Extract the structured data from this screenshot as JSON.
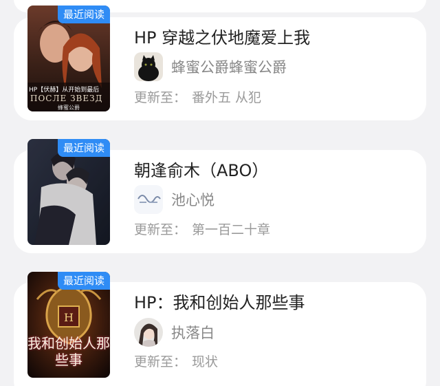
{
  "badge_label": "最近阅读",
  "update_prefix": "更新至：",
  "books": [
    {
      "title": "HP 穿越之伏地魔爱上我",
      "author": "蜂蜜公爵蜂蜜公爵",
      "update": "番外五 从犯",
      "cover_text": "HP【伏赫】从开始到最后",
      "cover_subtext": "ПОСЛЕ ЗВЕЗД",
      "cover_author": "蜂蜜公爵"
    },
    {
      "title": "朝逢俞木（ABO）",
      "author": "池心悦",
      "update": "第一百二十章"
    },
    {
      "title": "HP：我和创始人那些事",
      "author": "执落白",
      "update": "现状",
      "cover_text": "我和创始人那些事"
    }
  ],
  "colors": {
    "badge": "#2f8cf5",
    "background": "#f2f2f4",
    "card": "#ffffff",
    "title": "#222222",
    "muted": "#9a9a9a"
  }
}
